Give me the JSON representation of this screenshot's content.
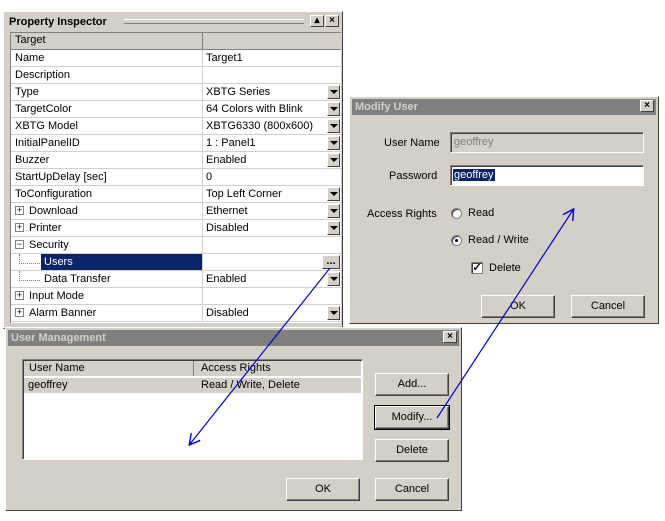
{
  "property_inspector": {
    "title": "Property Inspector",
    "header": "Target",
    "rows": [
      {
        "name": "Name",
        "value": "Target1"
      },
      {
        "name": "Description",
        "value": ""
      },
      {
        "name": "Type",
        "value": "XBTG Series"
      },
      {
        "name": "TargetColor",
        "value": "64 Colors with Blink"
      },
      {
        "name": "XBTG Model",
        "value": "XBTG6330 (800x600)"
      },
      {
        "name": "InitialPanelID",
        "value": "1 : Panel1"
      },
      {
        "name": "Buzzer",
        "value": "Enabled"
      },
      {
        "name": "StartUpDelay [sec]",
        "value": "0"
      },
      {
        "name": "ToConfiguration",
        "value": "Top Left Corner"
      },
      {
        "name": "Download",
        "value": "Ethernet"
      },
      {
        "name": "Printer",
        "value": "Disabled"
      },
      {
        "name": "Security",
        "value": ""
      },
      {
        "name": "Users",
        "value": ""
      },
      {
        "name": "Data Transfer",
        "value": "Enabled"
      },
      {
        "name": "Input Mode",
        "value": ""
      },
      {
        "name": "Alarm Banner",
        "value": "Disabled"
      }
    ],
    "ellipsis": "..."
  },
  "modify_user": {
    "title": "Modify User",
    "username_label": "User Name",
    "username_value": "geoffrey",
    "password_label": "Password",
    "password_value": "geoffrey",
    "access_label": "Access Rights",
    "read_label": "Read",
    "read_write_label": "Read / Write",
    "delete_label": "Delete",
    "ok_label": "OK",
    "cancel_label": "Cancel"
  },
  "user_management": {
    "title": "User Management",
    "columns": [
      "User Name",
      "Access Rights"
    ],
    "users": [
      {
        "name": "geoffrey",
        "rights": "Read / Write, Delete"
      }
    ],
    "add_label": "Add...",
    "modify_label": "Modify...",
    "delete_label": "Delete",
    "ok_label": "OK",
    "cancel_label": "Cancel"
  },
  "colors": {
    "selection": "#0a246a",
    "dialog_bg": "#d4d0c8",
    "arrow": "#0000cc"
  }
}
